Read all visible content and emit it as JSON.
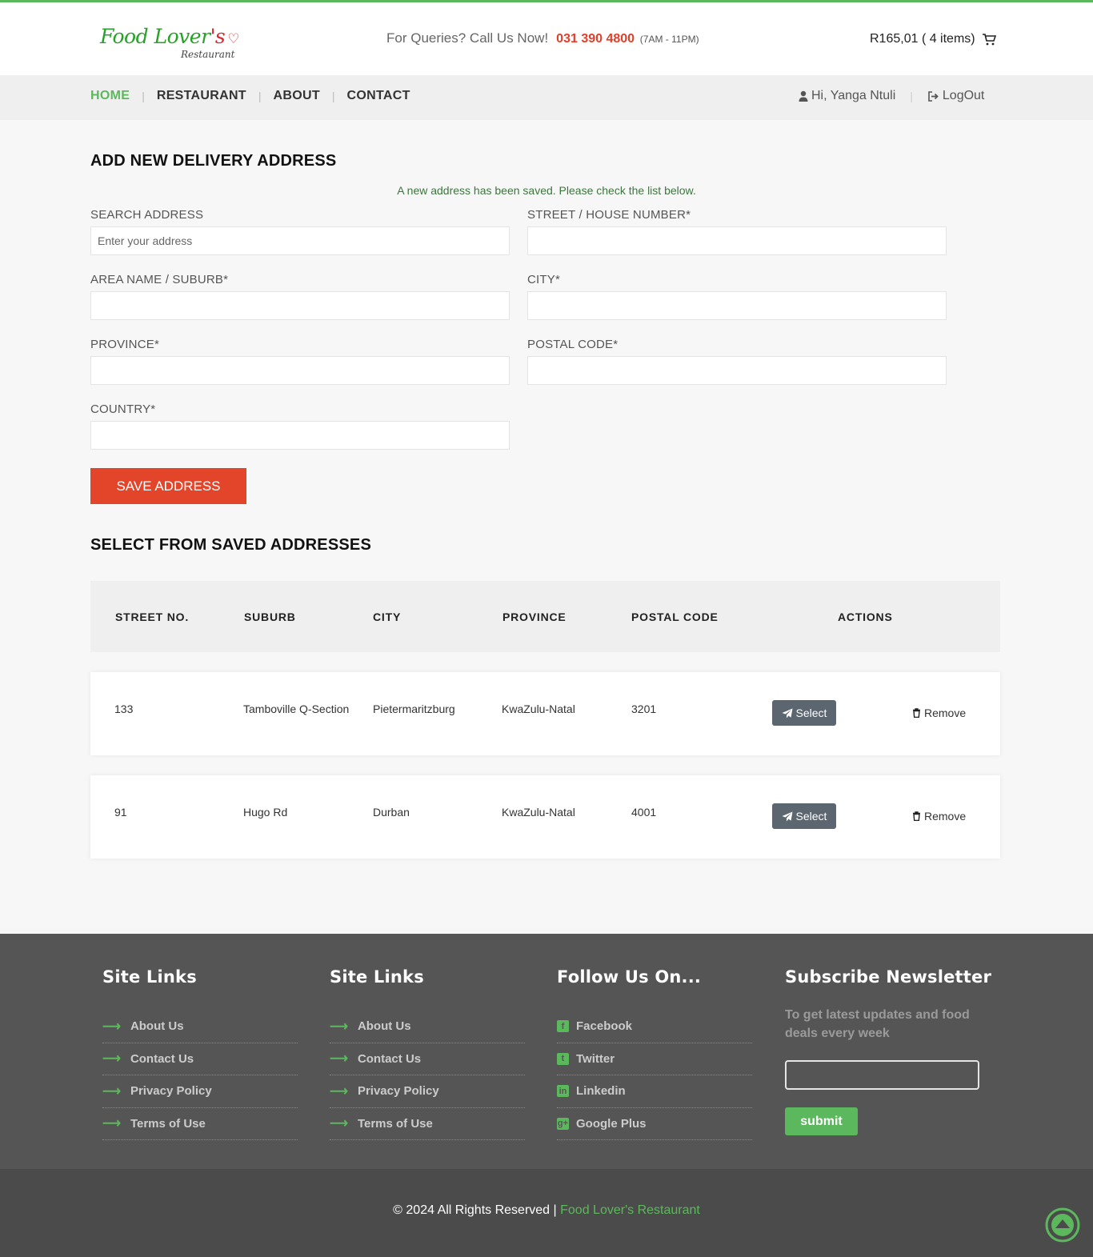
{
  "header": {
    "logo": {
      "main": "Food Lover",
      "apostrophe_s": "'s",
      "sub": "Restaurant"
    },
    "queries_label": "For Queries? Call Us Now!",
    "phone": "031 390 4800",
    "hours": "(7AM - 11PM)",
    "cart_text": "R165,01 ( 4 items)"
  },
  "nav": {
    "items": [
      {
        "label": "HOME",
        "active": true
      },
      {
        "label": "RESTAURANT",
        "active": false
      },
      {
        "label": "ABOUT",
        "active": false
      },
      {
        "label": "CONTACT",
        "active": false
      }
    ],
    "greeting": "Hi, Yanga Ntuli",
    "logout": "LogOut"
  },
  "form": {
    "title": "ADD NEW DELIVERY ADDRESS",
    "success_message": "A new address has been saved. Please check the list below.",
    "fields": {
      "search": {
        "label": "SEARCH ADDRESS",
        "placeholder": "Enter your address",
        "value": ""
      },
      "street": {
        "label": "STREET / HOUSE NUMBER*",
        "value": ""
      },
      "suburb": {
        "label": "AREA NAME / SUBURB*",
        "value": ""
      },
      "city": {
        "label": "CITY*",
        "value": ""
      },
      "province": {
        "label": "PROVINCE*",
        "value": ""
      },
      "postal": {
        "label": "POSTAL CODE*",
        "value": ""
      },
      "country": {
        "label": "COUNTRY*",
        "value": ""
      }
    },
    "save_label": "SAVE ADDRESS"
  },
  "saved": {
    "title": "SELECT FROM SAVED ADDRESSES",
    "columns": [
      "STREET NO.",
      "SUBURB",
      "CITY",
      "PROVINCE",
      "POSTAL CODE",
      "ACTIONS"
    ],
    "rows": [
      {
        "street": "133",
        "suburb": "Tamboville Q-Section",
        "city": "Pietermaritzburg",
        "province": "KwaZulu-Natal",
        "postal": "3201"
      },
      {
        "street": "91",
        "suburb": "Hugo Rd",
        "city": "Durban",
        "province": "KwaZulu-Natal",
        "postal": "4001"
      }
    ],
    "select_label": "Select",
    "remove_label": "Remove"
  },
  "footer": {
    "col1": {
      "title": "Site Links",
      "links": [
        "About Us",
        "Contact Us",
        "Privacy Policy",
        "Terms of Use"
      ]
    },
    "col2": {
      "title": "Site Links",
      "links": [
        "About Us",
        "Contact Us",
        "Privacy Policy",
        "Terms of Use"
      ]
    },
    "social": {
      "title": "Follow Us On...",
      "links": [
        {
          "label": "Facebook",
          "icon": "facebook-icon"
        },
        {
          "label": "Twitter",
          "icon": "twitter-icon"
        },
        {
          "label": "Linkedin",
          "icon": "linkedin-icon"
        },
        {
          "label": "Google Plus",
          "icon": "google-plus-icon"
        }
      ]
    },
    "newsletter": {
      "title": "Subscribe Newsletter",
      "text": "To get latest updates and food deals every week",
      "input_value": "",
      "submit_label": "submit"
    },
    "copyright": "© 2024 All Rights Reserved |",
    "brand": "Food Lover's Restaurant"
  },
  "colors": {
    "accent": "#5cb85c",
    "save_button": "#e3452a",
    "phone": "#e0402a",
    "footer": "#555555"
  }
}
